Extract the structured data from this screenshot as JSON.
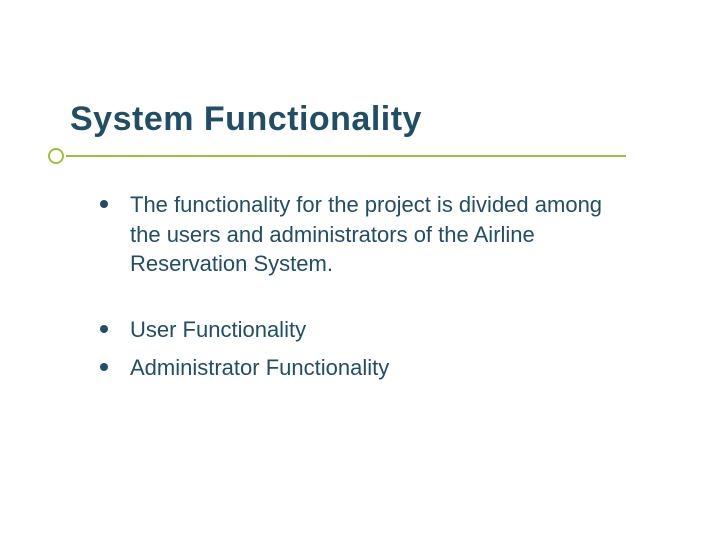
{
  "slide": {
    "title": "System Functionality",
    "bullets": [
      "The functionality for the project is divided among the users and administrators of the Airline Reservation System.",
      "User Functionality",
      "Administrator Functionality"
    ]
  },
  "colors": {
    "text": "#1f4e66",
    "accent": "#9fbf3b"
  }
}
